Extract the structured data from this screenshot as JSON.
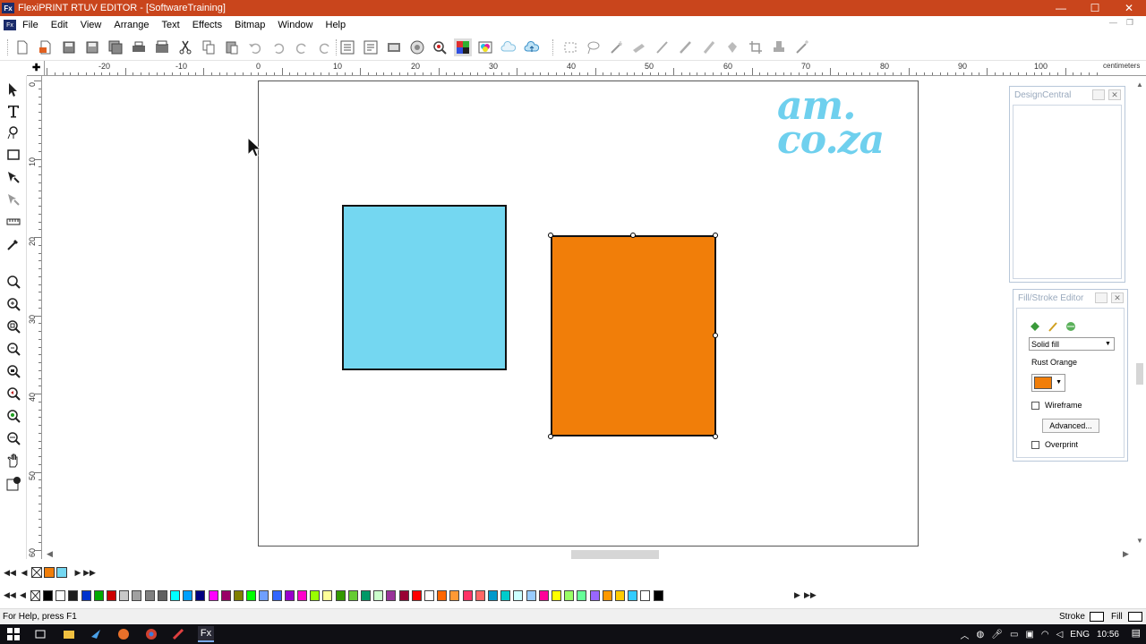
{
  "window": {
    "title": "FlexiPRINT RTUV EDITOR - [SoftwareTraining]",
    "app_icon_text": "Fx",
    "buttons": {
      "minimize": "—",
      "maximize": "☐",
      "close": "✕"
    }
  },
  "menu": {
    "items": [
      "File",
      "Edit",
      "View",
      "Arrange",
      "Text",
      "Effects",
      "Bitmap",
      "Window",
      "Help"
    ]
  },
  "toolbar": {
    "icons": [
      "new-icon",
      "open-icon",
      "save-icon",
      "save-as-icon",
      "save-all-icon",
      "print-icon",
      "print-preview-icon",
      "cut-icon",
      "copy-icon",
      "paste-icon",
      "undo-icon",
      "undo-list-icon",
      "redo-icon",
      "redo-list-icon",
      "import-icon",
      "export-icon",
      "color-wheel-icon",
      "pen-nib-icon",
      "color-grid-icon",
      "rgb-icon",
      "cloud-icon",
      "cloud-upload-icon",
      "marquee-select-icon",
      "lasso-icon",
      "magic-wand-icon",
      "knife-icon",
      "pen-icon",
      "pencil-icon",
      "eraser-icon",
      "crop-icon",
      "stamp-icon",
      "wand-effect-icon"
    ]
  },
  "rulers": {
    "unit": "centimeters",
    "h_labels": [
      "-20",
      "-10",
      "0",
      "10",
      "20",
      "30",
      "40",
      "50",
      "60",
      "70",
      "80",
      "90",
      "100"
    ],
    "v_labels": [
      "0",
      "10",
      "20",
      "30",
      "40",
      "50",
      "60"
    ],
    "corner": "✚"
  },
  "toolbox": {
    "tools": [
      "select-tool-icon",
      "text-tool-icon",
      "shape-tool-icon",
      "rectangle-tool-icon",
      "fill-tool-icon",
      "color-picker-tool-icon",
      "measure-tool-icon",
      "eyedropper-tool-icon",
      "zoom-fit-icon",
      "zoom-in-icon",
      "zoom-page-icon",
      "zoom-out-icon",
      "zoom-object-icon",
      "zoom-previous-icon",
      "zoom-all-icon",
      "zoom-width-icon",
      "hand-tool-icon",
      "fill-swatch-tool-icon"
    ]
  },
  "logo": {
    "line1": "am.",
    "line2": "co.za"
  },
  "colors": {
    "blue_rect": "#74d7f1",
    "orange_rect": "#f17e09",
    "titlebar": "#c9451c",
    "logo": "#6fd0ee"
  },
  "design_central": {
    "title": "DesignCentral"
  },
  "fill_stroke": {
    "title": "Fill/Stroke Editor",
    "fill_type": "Solid fill",
    "color_name": "Rust Orange",
    "wireframe_label": "Wireframe",
    "advanced_label": "Advanced...",
    "overprint_label": "Overprint",
    "wireframe_checked": false,
    "overprint_checked": false
  },
  "palette": {
    "colors": [
      "#000000",
      "#ffffff",
      "#1e1e1e",
      "#0033cc",
      "#00aa00",
      "#cc0000",
      "#c8c8c8",
      "#a0a0a0",
      "#808080",
      "#606060",
      "#00ffff",
      "#00a0ff",
      "#000080",
      "#ff00ff",
      "#990066",
      "#808000",
      "#00ff00",
      "#6f9fff",
      "#3366ff",
      "#9900cc",
      "#ff00cc",
      "#99ff00",
      "#ffff99",
      "#339900",
      "#66cc33",
      "#009966",
      "#ccffcc",
      "#993399",
      "#990033",
      "#ff0000",
      "#ffffff",
      "#ff6600",
      "#ff9933",
      "#ff3366",
      "#ff6666",
      "#0099cc",
      "#00cccc",
      "#ccffff",
      "#99ccff",
      "#ff0099",
      "#ffff00",
      "#99ff66",
      "#66ff99",
      "#9966ff",
      "#ff9900",
      "#ffcc00",
      "#33ccff",
      "#ffffff",
      "#000000"
    ]
  },
  "pagenav": {
    "swatches": [
      "#ffffff",
      "#f17e09",
      "#74d7f1"
    ]
  },
  "status": {
    "help": "For Help, press F1",
    "stroke_label": "Stroke",
    "fill_label": "Fill"
  },
  "taskbar": {
    "apps": [
      "start-icon",
      "task-view-icon",
      "file-explorer-icon",
      "edge-icon",
      "firefox-icon",
      "chrome-icon",
      "flexi-app-icon",
      "fx-app-icon"
    ],
    "language": "ENG",
    "time": "10:56"
  }
}
